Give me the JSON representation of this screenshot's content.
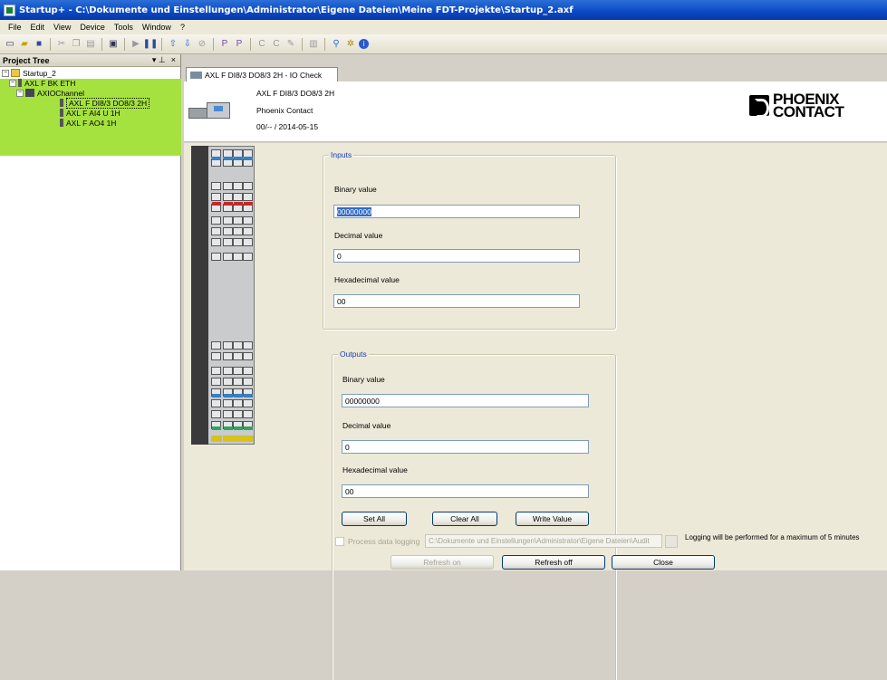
{
  "window": {
    "title": "Startup+ - C:\\Dokumente und Einstellungen\\Administrator\\Eigene Dateien\\Meine FDT-Projekte\\Startup_2.axf"
  },
  "menu": [
    "File",
    "Edit",
    "View",
    "Device",
    "Tools",
    "Window",
    "?"
  ],
  "project_tree": {
    "title": "Project Tree",
    "pin": "▾ ᵖ",
    "close": "×",
    "items": [
      {
        "label": "Startup_2"
      },
      {
        "label": "AXL F BK ETH"
      },
      {
        "label": "AXIOChannel"
      },
      {
        "label": "AXL F DI8/3 DO8/3 2H"
      },
      {
        "label": "AXL F AI4 U 1H"
      },
      {
        "label": "AXL F AO4 1H"
      }
    ]
  },
  "tab": {
    "label": "AXL F DI8/3 DO8/3 2H - IO Check"
  },
  "device": {
    "name": "AXL F DI8/3 DO8/3 2H",
    "vendor": "Phoenix Contact",
    "version": "00/-- / 2014-05-15",
    "logo_line1": "PHOENIX",
    "logo_line2": "CONTACT"
  },
  "inputs": {
    "title": "Inputs",
    "binary_label": "Binary value",
    "binary_value": "00000000",
    "decimal_label": "Decimal value",
    "decimal_value": "0",
    "hex_label": "Hexadecimal value",
    "hex_value": "00"
  },
  "outputs": {
    "title": "Outputs",
    "binary_label": "Binary value",
    "binary_value": "00000000",
    "decimal_label": "Decimal value",
    "decimal_value": "0",
    "hex_label": "Hexadecimal value",
    "hex_value": "00"
  },
  "buttons": {
    "set_all": "Set All",
    "clear_all": "Clear All",
    "write_value": "Write Value",
    "refresh_on": "Refresh on",
    "refresh_off": "Refresh off",
    "close": "Close"
  },
  "logging": {
    "checkbox_label": "Process data logging",
    "path": "C:\\Dokumente und Einstellungen\\Administrator\\Eigene Dateien\\Audit",
    "note": "Logging will be performed for a maximum of 5 minutes"
  },
  "colors": {
    "tree_highlight": "#a6e23f",
    "group_title": "#1a3fb5",
    "titlebar": "#0a48c6"
  }
}
